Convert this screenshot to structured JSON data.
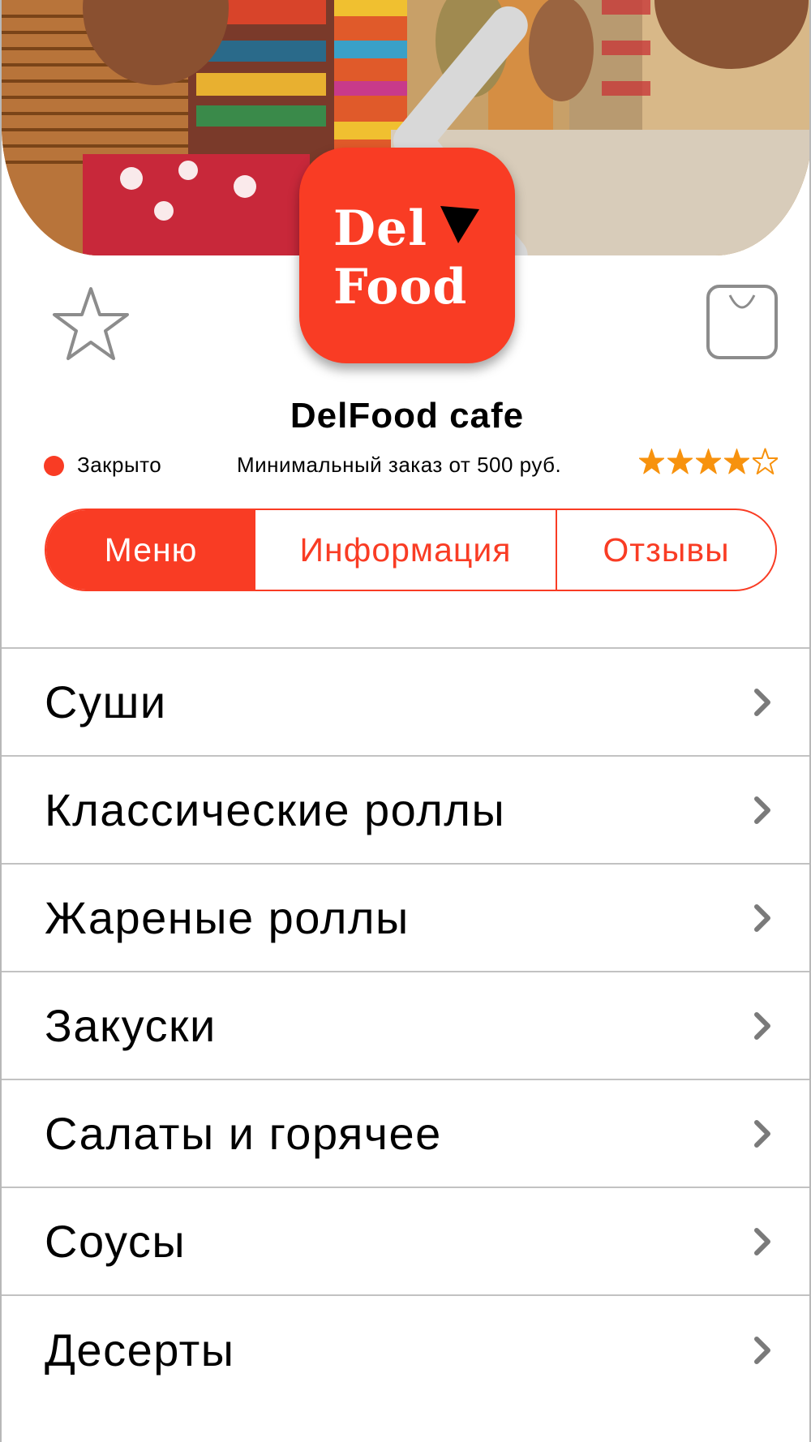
{
  "header": {
    "back_icon": "chevron-left-icon",
    "hero_image": "restaurant-interior-photo"
  },
  "logo": {
    "line1": "Del",
    "line2": "Food",
    "icon": "cursor-arrow-icon",
    "color": "#f93c24"
  },
  "actions": {
    "favorite_icon": "star-outline-icon",
    "cart_icon": "shopping-bag-icon"
  },
  "restaurant": {
    "name": "DelFood cafe",
    "status": "Закрыто",
    "status_color": "#f93c24",
    "min_order": "Минимальный заказ от 500 руб.",
    "rating": 4,
    "rating_max": 5,
    "rating_color": "#f7920e"
  },
  "tabs": [
    {
      "label": "Меню",
      "active": true
    },
    {
      "label": "Информация",
      "active": false
    },
    {
      "label": "Отзывы",
      "active": false
    }
  ],
  "menu_categories": [
    {
      "label": "Суши"
    },
    {
      "label": "Классические роллы"
    },
    {
      "label": "Жареные роллы"
    },
    {
      "label": "Закуски"
    },
    {
      "label": "Салаты и горячее"
    },
    {
      "label": "Соусы"
    },
    {
      "label": "Десерты"
    }
  ]
}
